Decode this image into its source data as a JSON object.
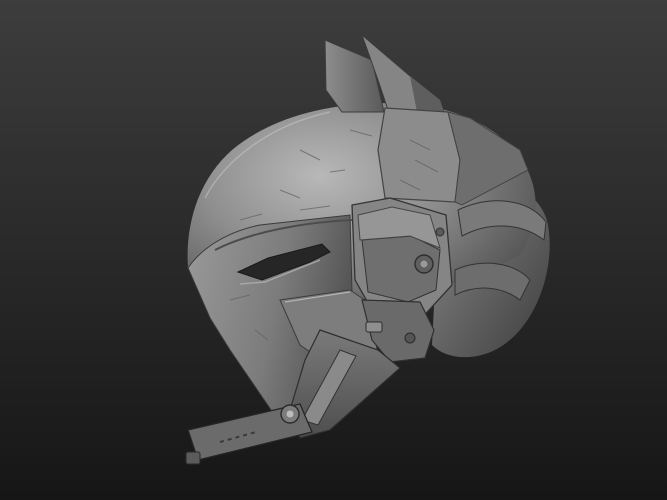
{
  "viewport": {
    "background_top_color": "#3d3d3d",
    "background_bottom_color": "#161616"
  },
  "model": {
    "icon_name": "helmet-sculpt",
    "material_color": "#8f8f8f",
    "shadow_color": "#3e3e3e",
    "highlight_color": "#c4c4c4"
  }
}
